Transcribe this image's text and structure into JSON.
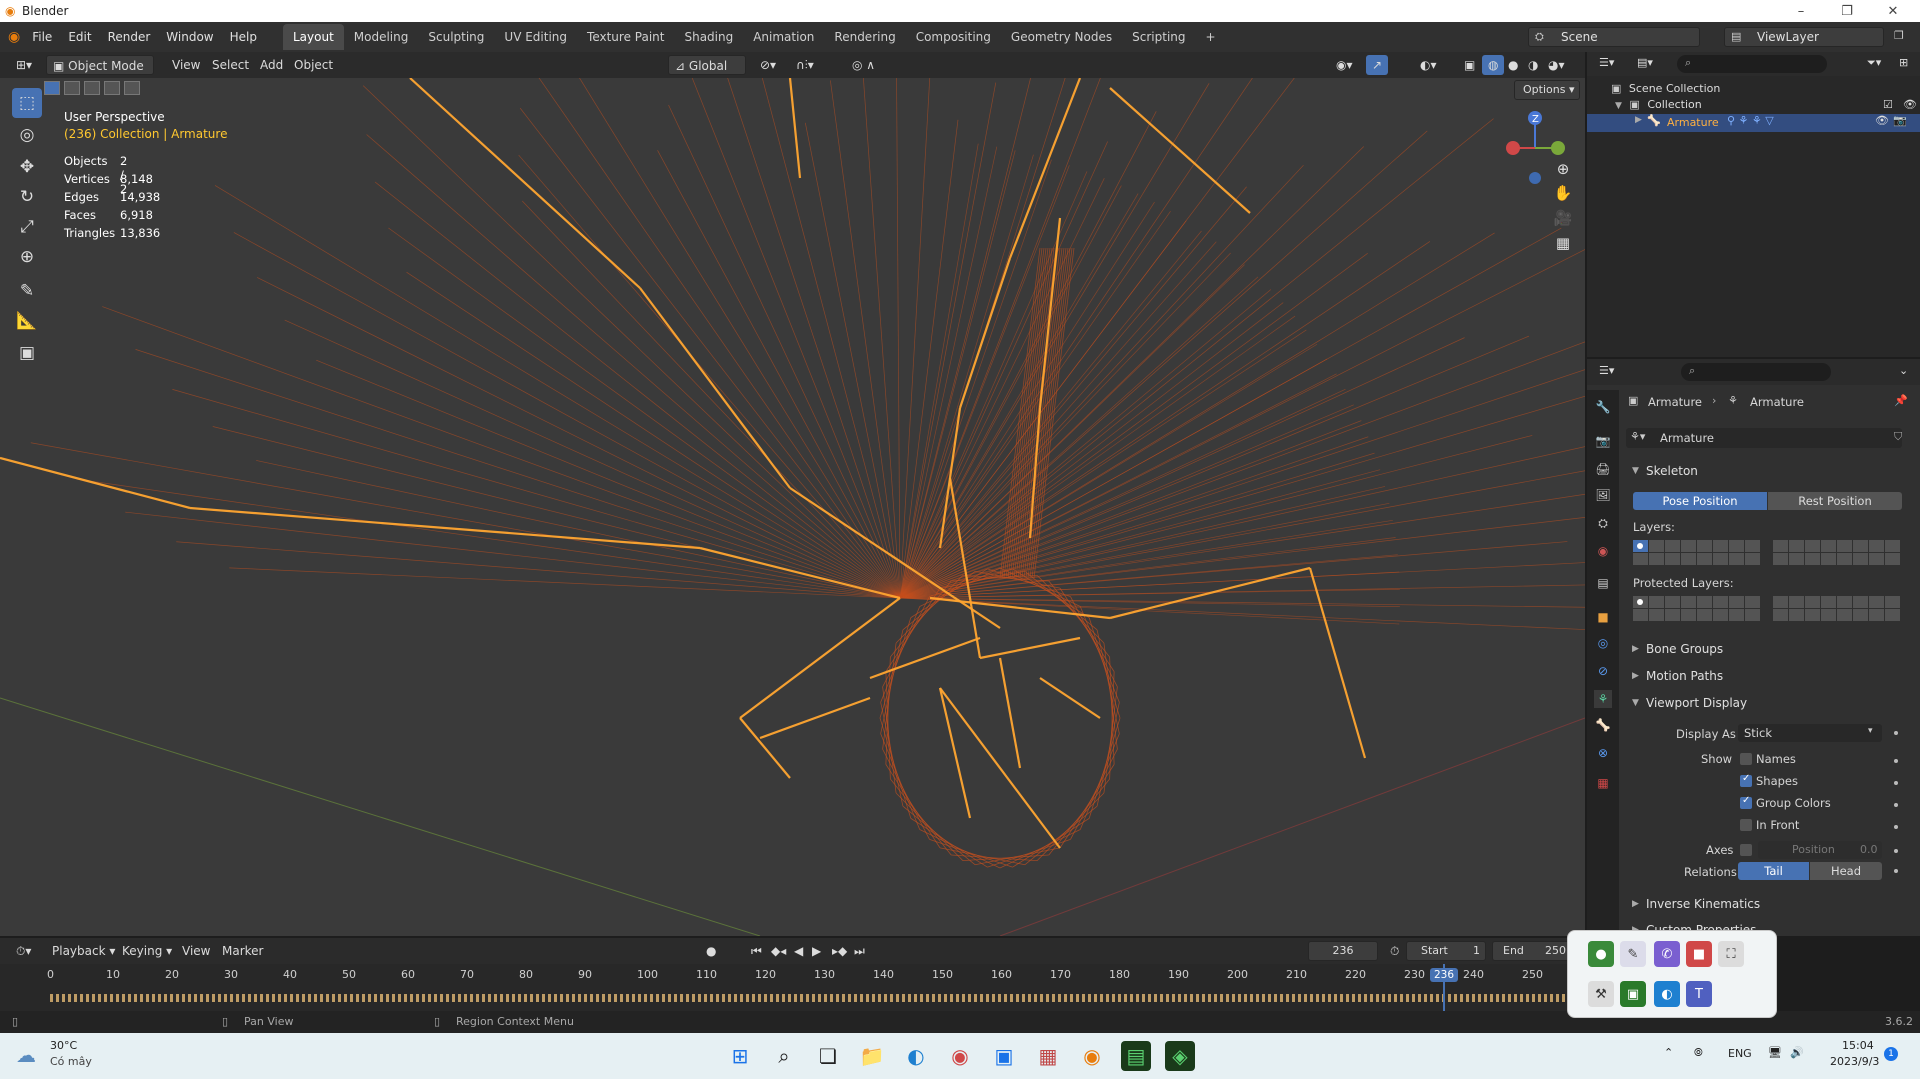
{
  "window": {
    "title": "Blender",
    "controls": [
      "–",
      "❐",
      "✕"
    ]
  },
  "menubar": {
    "items": [
      "File",
      "Edit",
      "Render",
      "Window",
      "Help"
    ],
    "workspace_tabs": [
      "Layout",
      "Modeling",
      "Sculpting",
      "UV Editing",
      "Texture Paint",
      "Shading",
      "Animation",
      "Rendering",
      "Compositing",
      "Geometry Nodes",
      "Scripting"
    ],
    "active_tab": "Layout",
    "add_tab": "+",
    "scene": "Scene",
    "view_layer": "ViewLayer"
  },
  "viewport_header": {
    "mode": "Object Mode",
    "menus": [
      "View",
      "Select",
      "Add",
      "Object"
    ],
    "orientation": "Global",
    "options": "Options"
  },
  "viewport": {
    "title": "User Perspective",
    "subtitle": "(236) Collection | Armature",
    "stats": [
      {
        "label": "Objects",
        "value": "2 / 2"
      },
      {
        "label": "Vertices",
        "value": "8,148"
      },
      {
        "label": "Edges",
        "value": "14,938"
      },
      {
        "label": "Faces",
        "value": "6,918"
      },
      {
        "label": "Triangles",
        "value": "13,836"
      }
    ],
    "wire_color": "#c8501e",
    "bone_color": "#ffa530"
  },
  "outliner": {
    "root": "Scene Collection",
    "collection": "Collection",
    "object": "Armature"
  },
  "properties": {
    "breadcrumb_object": "Armature",
    "breadcrumb_data": "Armature",
    "data_name": "Armature",
    "skeleton": {
      "title": "Skeleton",
      "pose_position": "Pose Position",
      "rest_position": "Rest Position",
      "layers_label": "Layers:",
      "protected_label": "Protected Layers:"
    },
    "bone_groups": "Bone Groups",
    "motion_paths": "Motion Paths",
    "viewport_display": {
      "title": "Viewport Display",
      "display_as_label": "Display As",
      "display_as_value": "Stick",
      "show_label": "Show",
      "names": "Names",
      "shapes": "Shapes",
      "group_colors": "Group Colors",
      "in_front": "In Front",
      "axes_label": "Axes",
      "position_label": "Position",
      "position_value": "0.0",
      "relations_label": "Relations",
      "tail": "Tail",
      "head": "Head"
    },
    "inverse_kinematics": "Inverse Kinematics",
    "custom_properties": "Custom Properties"
  },
  "timeline": {
    "menus": [
      "Playback",
      "Keying",
      "View",
      "Marker"
    ],
    "current_frame": "236",
    "start_label": "Start",
    "start_value": "1",
    "end_label": "End",
    "end_value": "250",
    "ticks": [
      "0",
      "10",
      "20",
      "30",
      "40",
      "50",
      "60",
      "70",
      "80",
      "90",
      "100",
      "110",
      "120",
      "130",
      "140",
      "150",
      "160",
      "170",
      "180",
      "190",
      "200",
      "210",
      "220",
      "230",
      "240",
      "250"
    ],
    "playhead_label": "236"
  },
  "statusbar": {
    "pan_view": "Pan View",
    "region_context": "Region Context Menu",
    "version": "3.6.2"
  },
  "taskbar": {
    "weather_temp": "30°C",
    "weather_desc": "Có mây",
    "lang": "ENG",
    "time": "15:04",
    "date": "2023/9/3",
    "notif_count": "1"
  }
}
